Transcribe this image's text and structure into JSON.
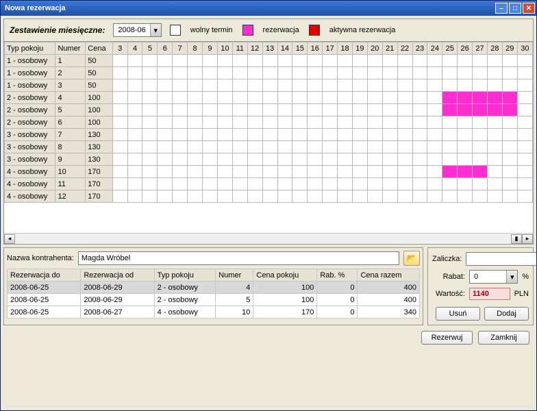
{
  "title": "Nowa rezerwacja",
  "summaryLabel": "Zestawienie miesięczne:",
  "month": "2008-06",
  "legend": {
    "free": "wolny termin",
    "res": "rezerwacja",
    "active": "aktywna rezerwacja"
  },
  "roomCols": {
    "type": "Typ pokoju",
    "num": "Numer",
    "price": "Cena"
  },
  "days": [
    "3",
    "4",
    "5",
    "6",
    "7",
    "8",
    "9",
    "10",
    "11",
    "12",
    "13",
    "14",
    "15",
    "16",
    "17",
    "18",
    "19",
    "20",
    "21",
    "22",
    "23",
    "24",
    "25",
    "26",
    "27",
    "28",
    "29",
    "30"
  ],
  "rooms": [
    {
      "type": "1 - osobowy",
      "num": "1",
      "price": "50",
      "res": []
    },
    {
      "type": "1 - osobowy",
      "num": "2",
      "price": "50",
      "res": []
    },
    {
      "type": "1 - osobowy",
      "num": "3",
      "price": "50",
      "res": []
    },
    {
      "type": "2 - osobowy",
      "num": "4",
      "price": "100",
      "res": [
        "25",
        "26",
        "27",
        "28",
        "29"
      ]
    },
    {
      "type": "2 - osobowy",
      "num": "5",
      "price": "100",
      "res": [
        "25",
        "26",
        "27",
        "28",
        "29"
      ]
    },
    {
      "type": "2 - osobowy",
      "num": "6",
      "price": "100",
      "res": []
    },
    {
      "type": "3 - osobowy",
      "num": "7",
      "price": "130",
      "res": []
    },
    {
      "type": "3 - osobowy",
      "num": "8",
      "price": "130",
      "res": []
    },
    {
      "type": "3 - osobowy",
      "num": "9",
      "price": "130",
      "res": []
    },
    {
      "type": "4 - osobowy",
      "num": "10",
      "price": "170",
      "res": [
        "25",
        "26",
        "27"
      ]
    },
    {
      "type": "4 - osobowy",
      "num": "11",
      "price": "170",
      "res": []
    },
    {
      "type": "4 - osobowy",
      "num": "12",
      "price": "170",
      "res": []
    }
  ],
  "contractorLabel": "Nazwa kontrahenta:",
  "contractor": "Magda Wróbel",
  "detCols": {
    "from": "Rezerwacja do",
    "to": "Rezerwacja od",
    "type": "Typ pokoju",
    "num": "Numer",
    "price": "Cena pokoju",
    "rab": "Rab. %",
    "total": "Cena razem"
  },
  "details": [
    {
      "from": "2008-06-25",
      "to": "2008-06-29",
      "type": "2 - osobowy",
      "num": "4",
      "price": "100",
      "rab": "0",
      "total": "400",
      "sel": true
    },
    {
      "from": "2008-06-25",
      "to": "2008-06-29",
      "type": "2 - osobowy",
      "num": "5",
      "price": "100",
      "rab": "0",
      "total": "400",
      "sel": false
    },
    {
      "from": "2008-06-25",
      "to": "2008-06-27",
      "type": "4 - osobowy",
      "num": "10",
      "price": "170",
      "rab": "0",
      "total": "340",
      "sel": false
    }
  ],
  "advanceLabel": "Zaliczka:",
  "discountLabel": "Rabat:",
  "discount": "0",
  "valueLabel": "Wartość:",
  "value": "1140",
  "currency": "PLN",
  "pct": "%",
  "btnDel": "Usuń",
  "btnAdd": "Dodaj",
  "btnReserve": "Rezerwuj",
  "btnClose": "Zamknij"
}
